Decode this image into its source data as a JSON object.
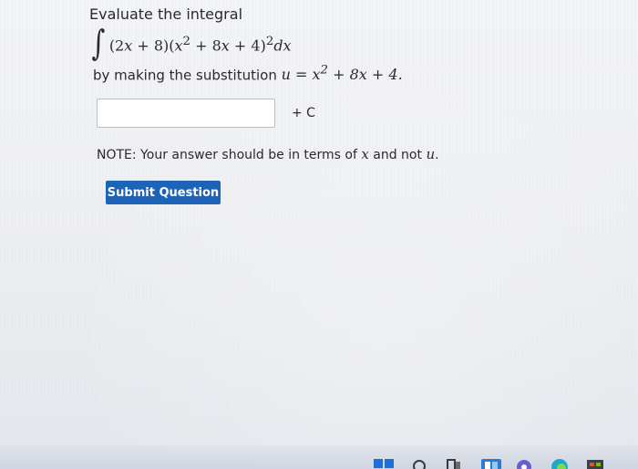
{
  "question": {
    "prompt": "Evaluate the integral",
    "integral_sign": "∫",
    "integrand_html": "(2<i>x</i> + 8)(<i>x</i><sup>2</sup> + 8<i>x</i> + 4)<sup>2</sup><i>dx</i>",
    "by_text": "by making the substitution ",
    "substitution_html": "<i>u</i> = <i>x</i><sup>2</sup> + 8<i>x</i> + 4."
  },
  "answer": {
    "value": "",
    "plus_c": "+ C"
  },
  "note": {
    "prefix": "NOTE: Your answer should be in terms of ",
    "var_x": "x",
    "middle": " and not ",
    "var_u": "u",
    "suffix": "."
  },
  "submit_label": "Submit Question",
  "colors": {
    "submit_bg": "#1d63b8",
    "text": "#2a2a2a",
    "background": "#f0f1f4"
  },
  "taskbar_icons": [
    "windows-start-icon",
    "search-icon",
    "task-view-icon",
    "widgets-icon",
    "chat-icon",
    "edge-browser-icon",
    "store-icon"
  ]
}
